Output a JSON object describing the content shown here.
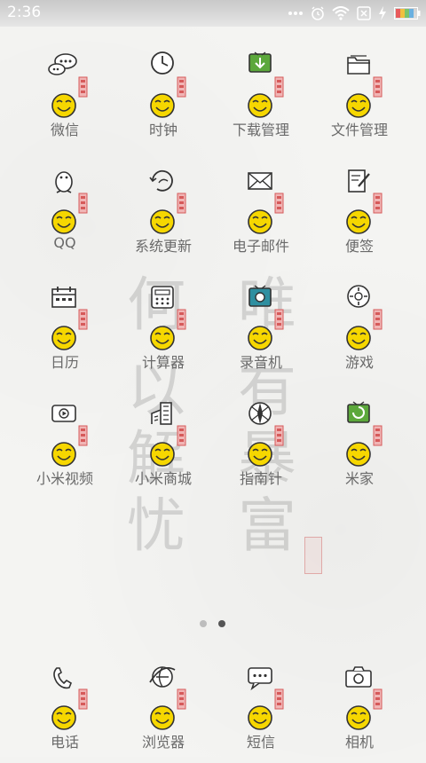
{
  "status_bar": {
    "time": "2:36"
  },
  "watermark": {
    "chars": [
      "何",
      "以",
      "解",
      "忧",
      "唯",
      "有",
      "暴",
      "富"
    ]
  },
  "apps": [
    {
      "label": "微信",
      "glyph": "chat-bubbles-icon"
    },
    {
      "label": "时钟",
      "glyph": "clock-icon"
    },
    {
      "label": "下载管理",
      "glyph": "download-tv-icon"
    },
    {
      "label": "文件管理",
      "glyph": "folder-icon"
    },
    {
      "label": "QQ",
      "glyph": "penguin-icon"
    },
    {
      "label": "系统更新",
      "glyph": "update-icon"
    },
    {
      "label": "电子邮件",
      "glyph": "envelope-icon"
    },
    {
      "label": "便签",
      "glyph": "notes-icon"
    },
    {
      "label": "日历",
      "glyph": "calendar-icon"
    },
    {
      "label": "计算器",
      "glyph": "calculator-icon"
    },
    {
      "label": "录音机",
      "glyph": "recorder-tv-icon"
    },
    {
      "label": "游戏",
      "glyph": "gamepad-icon"
    },
    {
      "label": "小米视频",
      "glyph": "video-icon"
    },
    {
      "label": "小米商城",
      "glyph": "building-icon"
    },
    {
      "label": "指南针",
      "glyph": "compass-icon"
    },
    {
      "label": "米家",
      "glyph": "home-tv-icon"
    }
  ],
  "dock": [
    {
      "label": "电话",
      "glyph": "phone-icon"
    },
    {
      "label": "浏览器",
      "glyph": "browser-icon"
    },
    {
      "label": "短信",
      "glyph": "message-icon"
    },
    {
      "label": "相机",
      "glyph": "camera-icon"
    }
  ],
  "page_indicator": {
    "pages": 2,
    "current": 2
  }
}
